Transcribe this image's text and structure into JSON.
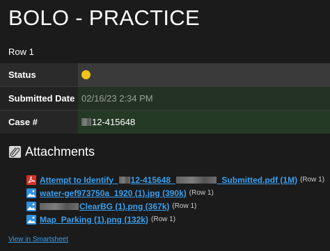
{
  "title": "BOLO - PRACTICE",
  "row_label": "Row 1",
  "fields": {
    "status": {
      "label": "Status",
      "indicator_color": "#f2c318"
    },
    "submitted_date": {
      "label": "Submitted Date",
      "value": "02/16/23 2:34 PM"
    },
    "case_number": {
      "label": "Case #",
      "value_suffix": "12-415648"
    }
  },
  "attachments": {
    "heading": "Attachments",
    "items": [
      {
        "icon": "pdf-icon",
        "text_start": "Attempt to Identify_",
        "text_mid": "12-415648_",
        "text_end": "_Submitted.pdf (1M)",
        "note": "(Row 1)"
      },
      {
        "icon": "image-icon",
        "text_start": "water-gef973750a_1920 (1).jpg (390k)",
        "note": "(Row 1)"
      },
      {
        "icon": "image-icon",
        "text_end": "ClearBG (1).png (367k)",
        "note": "(Row 1)"
      },
      {
        "icon": "image-icon",
        "text_start": "Map_Parking (1).png (132k)",
        "note": "(Row 1)"
      }
    ]
  },
  "footer_link": "View in Smartsheet"
}
